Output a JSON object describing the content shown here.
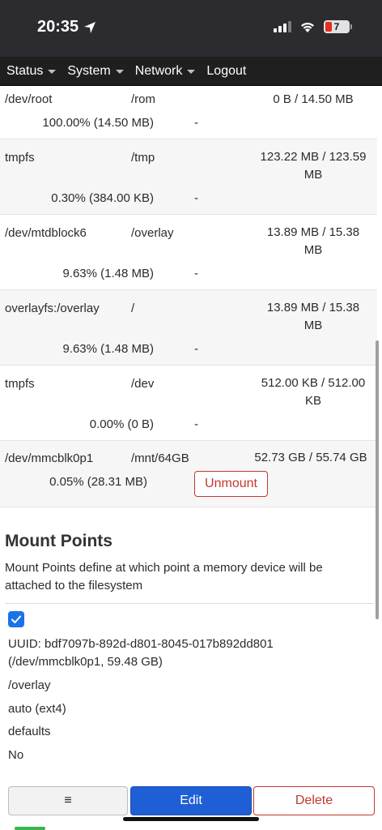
{
  "status_bar": {
    "time": "20:35",
    "battery": "7"
  },
  "nav": {
    "items": [
      "Status",
      "System",
      "Network",
      "Logout"
    ]
  },
  "filesystems": [
    {
      "device": "/dev/root",
      "mount": "/rom",
      "size_lines": [
        "0 B / 14.50 MB"
      ],
      "percent": "100.00% (14.50 MB)",
      "action": "-"
    },
    {
      "device": "tmpfs",
      "mount": "/tmp",
      "size_lines": [
        "123.22 MB / 123.59",
        "MB"
      ],
      "percent": "0.30% (384.00 KB)",
      "action": "-"
    },
    {
      "device": "/dev/mtdblock6",
      "mount": "/overlay",
      "size_lines": [
        "13.89 MB / 15.38",
        "MB"
      ],
      "percent": "9.63% (1.48 MB)",
      "action": "-"
    },
    {
      "device": "overlayfs:/overlay",
      "mount": "/",
      "size_lines": [
        "13.89 MB / 15.38",
        "MB"
      ],
      "percent": "9.63% (1.48 MB)",
      "action": "-"
    },
    {
      "device": "tmpfs",
      "mount": "/dev",
      "size_lines": [
        "512.00 KB / 512.00",
        "KB"
      ],
      "percent": "0.00% (0 B)",
      "action": "-"
    },
    {
      "device": "/dev/mmcblk0p1",
      "mount": "/mnt/64GB",
      "size_lines": [
        "52.73 GB / 55.74 GB"
      ],
      "percent": "0.05% (28.31 MB)",
      "action": "Unmount"
    }
  ],
  "mount_points": {
    "title": "Mount Points",
    "description": "Mount Points define at which point a memory device will be attached to the filesystem",
    "entry": {
      "enabled": true,
      "uuid_line1": "UUID: bdf7097b-892d-d801-8045-017b892dd801",
      "uuid_line2": "(/dev/mmcblk0p1, 59.48 GB)",
      "mount_point": "/overlay",
      "filesystem": "auto (ext4)",
      "options": "defaults",
      "root": "No"
    },
    "buttons": {
      "menu": "≡",
      "edit": "Edit",
      "delete": "Delete"
    }
  }
}
